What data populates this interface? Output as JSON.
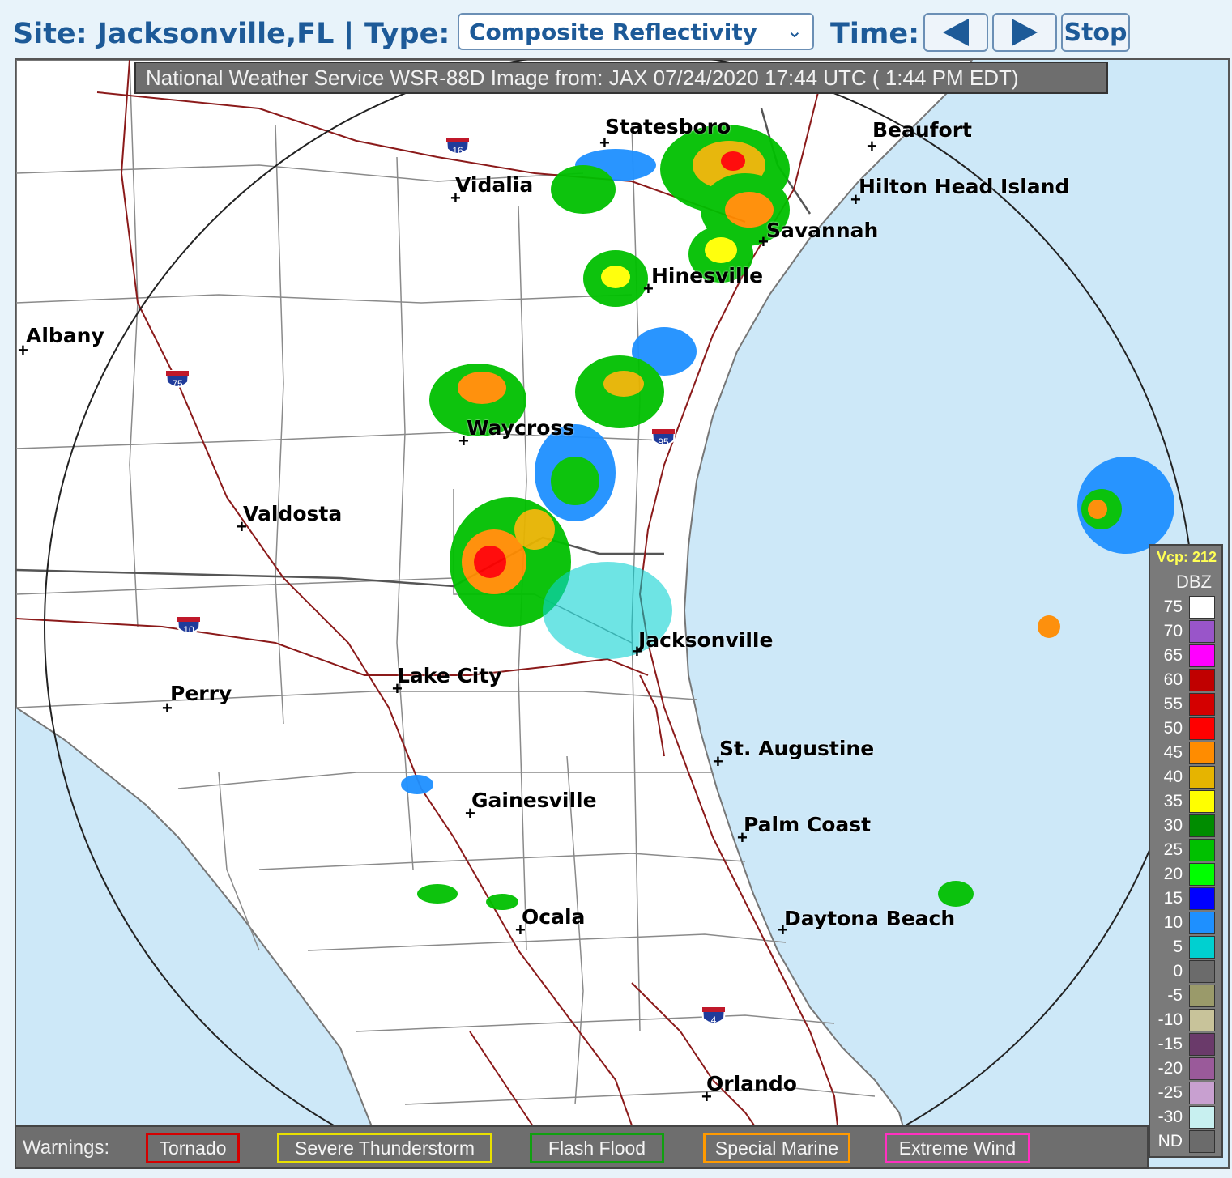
{
  "header": {
    "site": "Site: Jacksonville,FL | ",
    "type_label": "Type:",
    "type_selected": "Composite Reflectivity",
    "time_label": "Time:",
    "stop_label": "Stop"
  },
  "map": {
    "banner": "National Weather Service WSR-88D Image from: JAX 07/24/2020 17:44 UTC ( 1:44 PM EDT)",
    "cities": [
      "Statesboro",
      "Beaufort",
      "Vidalia",
      "Hilton Head Island",
      "Savannah",
      "Hinesville",
      "Albany",
      "Waycross",
      "Valdosta",
      "Jacksonville",
      "Lake City",
      "Perry",
      "St. Augustine",
      "Gainesville",
      "Palm Coast",
      "Ocala",
      "Daytona Beach",
      "Orlando"
    ],
    "interstates": [
      "16",
      "75",
      "95",
      "10",
      "4"
    ]
  },
  "legend": {
    "vcp": "Vcp: 212",
    "unit": "DBZ",
    "levels": [
      {
        "label": "75",
        "color": "#ffffff"
      },
      {
        "label": "70",
        "color": "#9955c9"
      },
      {
        "label": "65",
        "color": "#ff00ff"
      },
      {
        "label": "60",
        "color": "#c00000"
      },
      {
        "label": "55",
        "color": "#d40000"
      },
      {
        "label": "50",
        "color": "#ff0000"
      },
      {
        "label": "45",
        "color": "#ff8c00"
      },
      {
        "label": "40",
        "color": "#e6b400"
      },
      {
        "label": "35",
        "color": "#ffff00"
      },
      {
        "label": "30",
        "color": "#008c00"
      },
      {
        "label": "25",
        "color": "#00c000"
      },
      {
        "label": "20",
        "color": "#00ff00"
      },
      {
        "label": "15",
        "color": "#0000ff"
      },
      {
        "label": "10",
        "color": "#1e90ff"
      },
      {
        "label": "5",
        "color": "#00d0d0"
      },
      {
        "label": "0",
        "color": "#6b6b6b"
      },
      {
        "label": "-5",
        "color": "#9a9a6a"
      },
      {
        "label": "-10",
        "color": "#c8c39a"
      },
      {
        "label": "-15",
        "color": "#6a3a6a"
      },
      {
        "label": "-20",
        "color": "#9a5a9a"
      },
      {
        "label": "-25",
        "color": "#c8a0d0"
      },
      {
        "label": "-30",
        "color": "#c8f0f0"
      },
      {
        "label": "ND",
        "color": "#6b6b6b"
      }
    ]
  },
  "warnings": {
    "label": "Warnings:",
    "items": [
      {
        "label": "Tornado",
        "color": "#d40000"
      },
      {
        "label": "Severe Thunderstorm",
        "color": "#e8e000"
      },
      {
        "label": "Flash Flood",
        "color": "#10a010"
      },
      {
        "label": "Special Marine",
        "color": "#ff9a00"
      },
      {
        "label": "Extreme Wind",
        "color": "#ff30c0"
      }
    ]
  }
}
